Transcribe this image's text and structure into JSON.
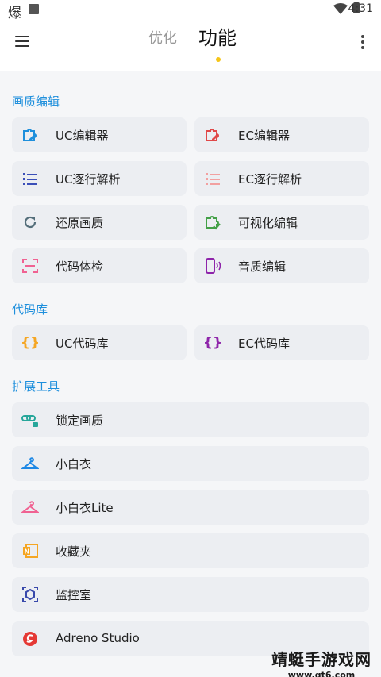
{
  "status_bar": {
    "left_char": "爆",
    "time": "4:31"
  },
  "header": {
    "tabs": [
      {
        "label": "优化"
      },
      {
        "label": "功能"
      }
    ]
  },
  "sections": [
    {
      "title": "画质编辑",
      "items": [
        {
          "label": "UC编辑器",
          "icon": "puzzle-edit-icon",
          "color": "#1e8fdc"
        },
        {
          "label": "EC编辑器",
          "icon": "puzzle-edit-icon",
          "color": "#e04848"
        },
        {
          "label": "UC逐行解析",
          "icon": "list-icon",
          "color": "#3b4fb8"
        },
        {
          "label": "EC逐行解析",
          "icon": "list-icon",
          "color": "#f2a0a0"
        },
        {
          "label": "还原画质",
          "icon": "refresh-icon",
          "color": "#546e7a"
        },
        {
          "label": "可视化编辑",
          "icon": "puzzle-check-icon",
          "color": "#43a047"
        },
        {
          "label": "代码体检",
          "icon": "scan-icon",
          "color": "#f06292"
        },
        {
          "label": "音质编辑",
          "icon": "phone-sound-icon",
          "color": "#8e24aa"
        }
      ]
    },
    {
      "title": "代码库",
      "items": [
        {
          "label": "UC代码库",
          "icon": "braces-icon",
          "color": "#f5a623"
        },
        {
          "label": "EC代码库",
          "icon": "braces-icon",
          "color": "#8e24aa"
        }
      ]
    },
    {
      "title": "扩展工具",
      "items": [
        {
          "label": "锁定画质",
          "icon": "link-lock-icon",
          "color": "#26a69a"
        },
        {
          "label": "小白衣",
          "icon": "hanger-icon",
          "color": "#1e88e5"
        },
        {
          "label": "小白衣Lite",
          "icon": "hanger-icon",
          "color": "#f06292"
        },
        {
          "label": "收藏夹",
          "icon": "notebook-icon",
          "color": "#f5a623"
        },
        {
          "label": "监控室",
          "icon": "cube-icon",
          "color": "#3949ab"
        },
        {
          "label": "Adreno Studio",
          "icon": "adreno-icon",
          "color": "#e53935"
        }
      ]
    }
  ],
  "watermark": {
    "main": "靖蜓手游戏网",
    "url": "www.qt6.com"
  }
}
